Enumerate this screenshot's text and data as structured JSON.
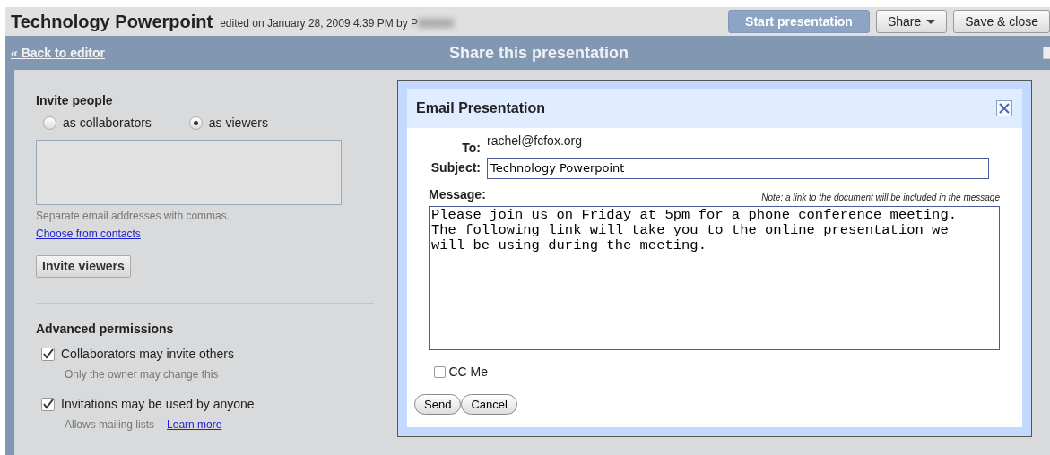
{
  "document": {
    "title": "Technology Powerpoint",
    "edited": "edited on January 28, 2009 4:39 PM by P"
  },
  "toolbar_buttons": [
    {
      "label": "Start presentation",
      "disabled": true,
      "has_menu": false
    },
    {
      "label": "Share",
      "disabled": false,
      "has_menu": true
    },
    {
      "label": "Save & close",
      "disabled": false,
      "has_menu": false
    }
  ],
  "share_bar": {
    "back_link": "« Back to editor",
    "title": "Share this presentation"
  },
  "invite": {
    "heading": "Invite people",
    "roles": [
      {
        "label": "as collaborators",
        "selected": false
      },
      {
        "label": "as viewers",
        "selected": true
      }
    ],
    "hint": "Separate email addresses with commas.",
    "contacts_link": "Choose from contacts",
    "button": "Invite viewers"
  },
  "advanced": {
    "heading": "Advanced permissions",
    "options": [
      {
        "label": "Collaborators may invite others",
        "checked": true,
        "note": "Only the owner may change this"
      },
      {
        "label": "Invitations may be used by anyone",
        "checked": true,
        "note": "Allows mailing lists",
        "link": "Learn more"
      }
    ]
  },
  "dialog": {
    "title": "Email Presentation",
    "to_label": "To:",
    "to": "rachel@fcfox.org",
    "subject_label": "Subject:",
    "subject": "Technology Powerpoint",
    "message_label": "Message:",
    "note": "Note: a link to the document will be included in the message",
    "message": "Please join us on Friday at 5pm for a phone conference meeting.\nThe following link will take you to the online presentation we\nwill be using during the meeting.",
    "cc": {
      "label": "CC Me",
      "checked": false
    },
    "buttons": [
      "Send",
      "Cancel"
    ]
  }
}
